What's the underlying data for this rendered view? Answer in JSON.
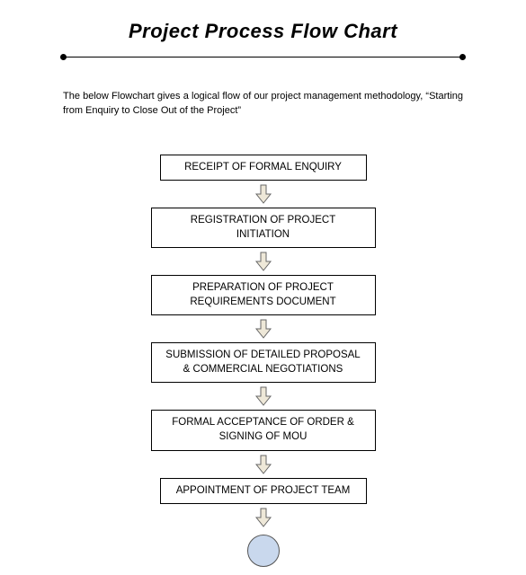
{
  "title": "Project Process Flow Chart",
  "intro": "The below Flowchart gives a logical flow of our project management methodology, “Starting from Enquiry to Close Out of the Project”",
  "steps": [
    "RECEIPT OF FORMAL ENQUIRY",
    "REGISTRATION OF PROJECT INITIATION",
    "PREPARATION OF PROJECT REQUIREMENTS DOCUMENT",
    "SUBMISSION OF DETAILED PROPOSAL & COMMERCIAL NEGOTIATIONS",
    "FORMAL ACCEPTANCE OF ORDER & SIGNING OF MOU",
    "APPOINTMENT OF PROJECT TEAM"
  ],
  "terminal_shape": "circle",
  "arrow_fill": "#eee8d8",
  "arrow_stroke": "#666",
  "circle_fill": "#c9d8ed"
}
